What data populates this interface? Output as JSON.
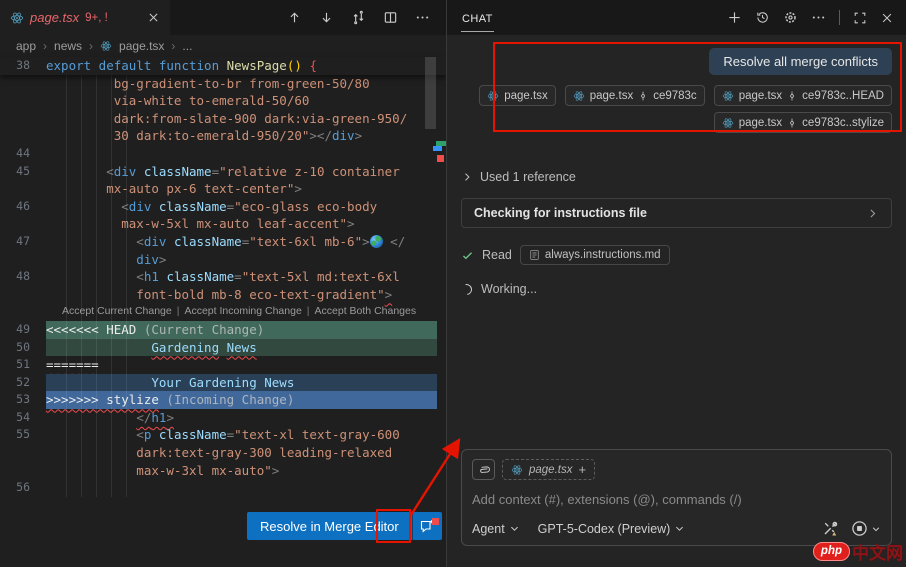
{
  "colors": {
    "accent_button": "#0e70c0",
    "annotation_red": "#e51400",
    "merge_current_header": "#40695c",
    "merge_current_content": "#32493f",
    "merge_incoming_header": "#40689b",
    "merge_incoming_content": "#2a4057",
    "error_red": "#f14c4c",
    "tab_conflict_text": "#e4676b"
  },
  "window": {
    "tab": {
      "file": "page.tsx",
      "badge": "9+, !"
    },
    "breadcrumb": [
      "app",
      "news",
      "page.tsx",
      "..."
    ],
    "editor_actions": [
      "previous-conflict",
      "next-conflict",
      "open-changes",
      "split-editor",
      "more-actions"
    ]
  },
  "editor": {
    "code_lens": {
      "items": [
        "Accept Current Change",
        "Accept Incoming Change",
        "Accept Both Changes"
      ]
    },
    "resolve_button": "Resolve in Merge Editor",
    "rows": [
      {
        "n": "38",
        "sticky": true,
        "segs": [
          [
            "kw",
            "export default function "
          ],
          [
            "fn",
            "NewsPage"
          ],
          [
            "bry",
            "()"
          ],
          [
            "pl",
            " "
          ],
          [
            "brr",
            "{"
          ]
        ]
      },
      {
        "n": "",
        "segs": [
          [
            "st",
            "         bg-gradient-to-br from-green-50/80"
          ]
        ]
      },
      {
        "n": "",
        "segs": [
          [
            "st",
            "         via-white to-emerald-50/60"
          ]
        ]
      },
      {
        "n": "",
        "segs": [
          [
            "st",
            "         dark:from-slate-900 dark:via-green-950/"
          ]
        ]
      },
      {
        "n": "",
        "segs": [
          [
            "st",
            "         30 dark:to-emerald-950/20\""
          ],
          [
            "pu",
            "></"
          ],
          [
            "tag",
            "div"
          ],
          [
            "pu",
            ">"
          ]
        ]
      },
      {
        "n": "44",
        "segs": []
      },
      {
        "n": "45",
        "segs": [
          [
            "pu",
            "        <"
          ],
          [
            "tag",
            "div"
          ],
          [
            "pl",
            " "
          ],
          [
            "attr",
            "className"
          ],
          [
            "pu",
            "="
          ],
          [
            "st",
            "\"relative z-10 container"
          ]
        ]
      },
      {
        "n": "",
        "segs": [
          [
            "st",
            "        mx-auto px-6 text-center\""
          ],
          [
            "pu",
            ">"
          ]
        ]
      },
      {
        "n": "46",
        "segs": [
          [
            "pu",
            "          <"
          ],
          [
            "tag",
            "div"
          ],
          [
            "pl",
            " "
          ],
          [
            "attr",
            "className"
          ],
          [
            "pu",
            "="
          ],
          [
            "st",
            "\"eco-glass eco-body"
          ]
        ]
      },
      {
        "n": "",
        "segs": [
          [
            "st",
            "          max-w-5xl mx-auto leaf-accent\""
          ],
          [
            "pu",
            ">"
          ]
        ]
      },
      {
        "n": "47",
        "segs": [
          [
            "pu",
            "            <"
          ],
          [
            "tag",
            "div"
          ],
          [
            "pl",
            " "
          ],
          [
            "attr",
            "className"
          ],
          [
            "pu",
            "="
          ],
          [
            "st",
            "\"text-6xl mb-6\""
          ],
          [
            "pu",
            ">"
          ],
          [
            "emoji",
            "🌍"
          ],
          [
            "pl",
            " "
          ],
          [
            "pu",
            "</"
          ]
        ]
      },
      {
        "n": "",
        "segs": [
          [
            "tag",
            "            div"
          ],
          [
            "pu",
            ">"
          ]
        ]
      },
      {
        "n": "48",
        "segs": [
          [
            "pu",
            "            <"
          ],
          [
            "tag",
            "h1"
          ],
          [
            "pl",
            " "
          ],
          [
            "attr",
            "className"
          ],
          [
            "pu",
            "="
          ],
          [
            "st",
            "\"text-5xl md:text-6xl"
          ]
        ]
      },
      {
        "n": "",
        "segs": [
          [
            "st",
            "            font-bold mb-8 eco-text-gradient\""
          ],
          [
            "pu sq",
            ">"
          ]
        ]
      },
      {
        "n": "",
        "lens": true,
        "segs": []
      },
      {
        "n": "49",
        "bg": "curhead",
        "segs": [
          [
            "mm sq",
            "<<<<<<< HEAD"
          ],
          [
            "dim",
            " (Current Change)"
          ]
        ]
      },
      {
        "n": "50",
        "bg": "curbody",
        "segs": [
          [
            "pl",
            "              "
          ],
          [
            "tx sq",
            "Gardening"
          ],
          [
            "pl",
            " "
          ],
          [
            "tx sq",
            "News"
          ]
        ]
      },
      {
        "n": "51",
        "segs": [
          [
            "mm sq",
            "======="
          ]
        ]
      },
      {
        "n": "52",
        "bg": "incbody",
        "segs": [
          [
            "pl",
            "              "
          ],
          [
            "tx",
            "Your Gardening News"
          ]
        ]
      },
      {
        "n": "53",
        "bg": "inchead",
        "segs": [
          [
            "mm sq",
            ">>>>>>> stylize"
          ],
          [
            "dim",
            " (Incoming Change)"
          ]
        ]
      },
      {
        "n": "54",
        "segs": [
          [
            "pl",
            "            "
          ],
          [
            "pu sq",
            "</"
          ],
          [
            "tag sq",
            "h1"
          ],
          [
            "pu sq",
            ">"
          ]
        ]
      },
      {
        "n": "55",
        "segs": [
          [
            "pu",
            "            <"
          ],
          [
            "tag",
            "p"
          ],
          [
            "pl",
            " "
          ],
          [
            "attr",
            "className"
          ],
          [
            "pu",
            "="
          ],
          [
            "st",
            "\"text-xl text-gray-600"
          ]
        ]
      },
      {
        "n": "",
        "segs": [
          [
            "st",
            "            dark:text-gray-300 leading-relaxed"
          ]
        ]
      },
      {
        "n": "",
        "segs": [
          [
            "st",
            "            max-w-3xl mx-auto\""
          ],
          [
            "pu",
            ">"
          ]
        ]
      },
      {
        "n": "56",
        "segs": []
      }
    ]
  },
  "chat": {
    "title": "CHAT",
    "header_actions": [
      "new-chat",
      "history",
      "configure",
      "more",
      "maximize",
      "close"
    ],
    "request": {
      "text": "Resolve all merge conflicts"
    },
    "request_chips": [
      {
        "file": "page.tsx",
        "ref": ""
      },
      {
        "file": "page.tsx",
        "ref": "ce9783c"
      },
      {
        "file": "page.tsx",
        "ref": "ce9783c..HEAD"
      },
      {
        "file": "page.tsx",
        "ref": "ce9783c..stylize"
      }
    ],
    "used_reference": "Used 1 reference",
    "tool_box": "Checking for instructions file",
    "read_step": {
      "verb": "Read",
      "file": "always.instructions.md"
    },
    "working": "Working...",
    "input": {
      "context_chip": "page.tsx",
      "context_add": "+",
      "placeholder": "Add context (#), extensions (@), commands (/)",
      "mode": "Agent",
      "model": "GPT-5-Codex (Preview)"
    }
  },
  "watermark": {
    "brand": "php",
    "text": "中文网"
  }
}
